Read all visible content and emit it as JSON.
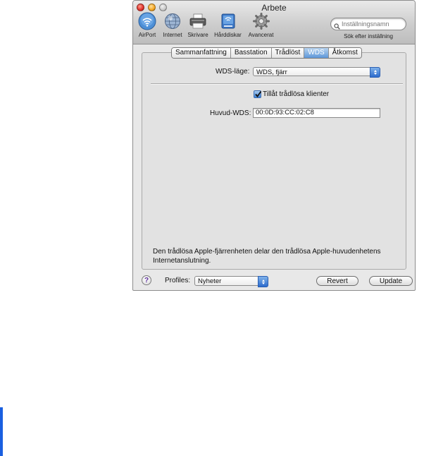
{
  "window": {
    "title": "Arbete"
  },
  "toolbar": {
    "items": [
      {
        "label": "AirPort",
        "icon": "airport-icon"
      },
      {
        "label": "Internet",
        "icon": "internet-globe-icon"
      },
      {
        "label": "Skrivare",
        "icon": "printer-icon"
      },
      {
        "label": "Hårddiskar",
        "icon": "hard-disk-icon"
      },
      {
        "label": "Avancerat",
        "icon": "gear-icon"
      }
    ],
    "search": {
      "placeholder": "Inställningsnamn",
      "caption": "Sök efter inställning"
    }
  },
  "tabs": [
    "Sammanfattning",
    "Basstation",
    "Trådlöst",
    "WDS",
    "Åtkomst"
  ],
  "active_tab": "WDS",
  "form": {
    "wds_mode_label": "WDS-läge:",
    "wds_mode_value": "WDS, fjärr",
    "allow_clients_label": "Tillåt trådlösa klienter",
    "allow_clients_checked": true,
    "main_wds_label": "Huvud-WDS:",
    "main_wds_value": "00:0D:93:CC:02:C8"
  },
  "info_text": "Den trådlösa Apple-fjärrenheten delar den trådlösa Apple-huvudenhetens Internetanslutning.",
  "bottom": {
    "help": "?",
    "profiles_label": "Profiles:",
    "profiles_value": "Nyheter",
    "revert_label": "Revert",
    "update_label": "Update"
  },
  "colors": {
    "selection_blue": "#5e98d9",
    "page_accent": "#1a5fe0"
  }
}
